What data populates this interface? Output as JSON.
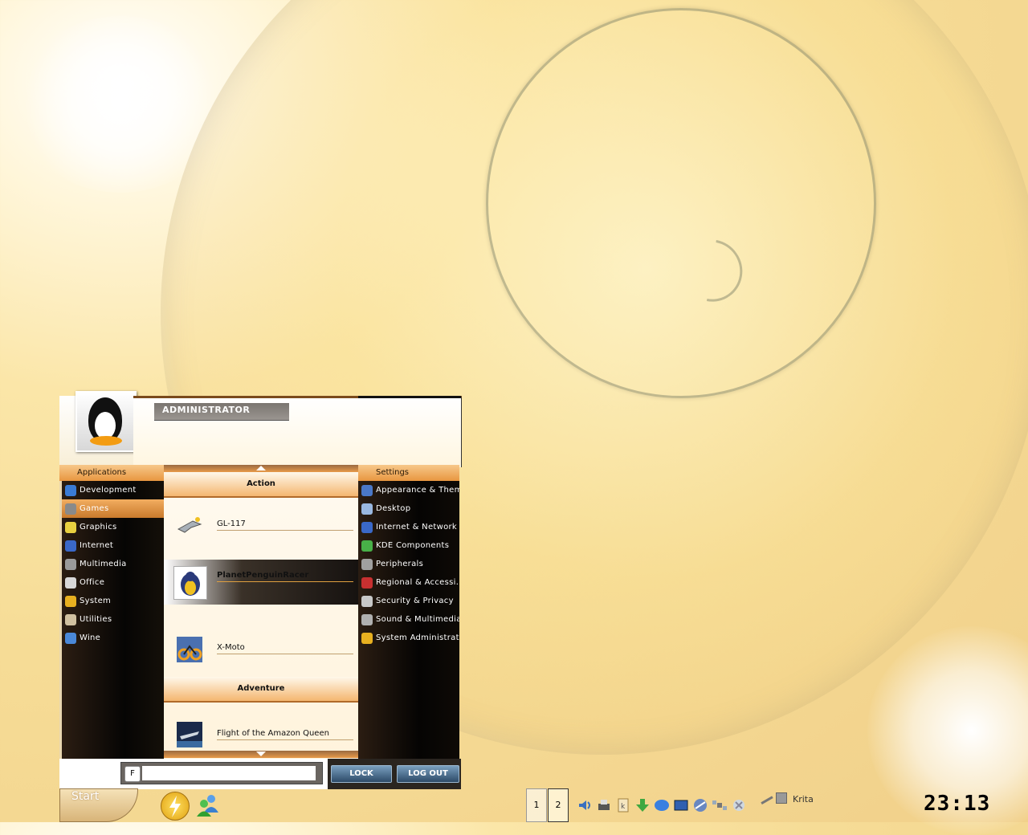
{
  "menu": {
    "user": "ADMINISTRATOR",
    "applications_header": "Applications",
    "settings_header": "Settings",
    "applications": [
      {
        "label": "Development",
        "icon": "development-icon",
        "color": "#3a7bd5"
      },
      {
        "label": "Games",
        "icon": "games-icon",
        "color": "#8a8a8a",
        "selected": true
      },
      {
        "label": "Graphics",
        "icon": "graphics-icon",
        "color": "#e8d040"
      },
      {
        "label": "Internet",
        "icon": "internet-icon",
        "color": "#3a68c8"
      },
      {
        "label": "Multimedia",
        "icon": "multimedia-icon",
        "color": "#9a9a9a"
      },
      {
        "label": "Office",
        "icon": "office-icon",
        "color": "#d8d8d8"
      },
      {
        "label": "System",
        "icon": "system-icon",
        "color": "#e8b020"
      },
      {
        "label": "Utilities",
        "icon": "utilities-icon",
        "color": "#d0c0a0"
      },
      {
        "label": "Wine",
        "icon": "wine-icon",
        "color": "#4a88d8"
      }
    ],
    "settings": [
      {
        "label": "Appearance & Them...",
        "icon": "appearance-icon",
        "color": "#4a78c8"
      },
      {
        "label": "Desktop",
        "icon": "desktop-icon",
        "color": "#9ab8e0"
      },
      {
        "label": "Internet & Network",
        "icon": "network-icon",
        "color": "#3a68c8"
      },
      {
        "label": "KDE Components",
        "icon": "components-icon",
        "color": "#48b048"
      },
      {
        "label": "Peripherals",
        "icon": "peripherals-icon",
        "color": "#a0a0a0"
      },
      {
        "label": "Regional & Accessi...",
        "icon": "regional-icon",
        "color": "#c83030"
      },
      {
        "label": "Security & Privacy",
        "icon": "security-icon",
        "color": "#c8c8c8"
      },
      {
        "label": "Sound & Multimedia",
        "icon": "sound-icon",
        "color": "#b0b0b0"
      },
      {
        "label": "System Administrati...",
        "icon": "sysadmin-icon",
        "color": "#e8b020"
      }
    ],
    "categories": [
      {
        "name": "Action",
        "entries": [
          {
            "label": "GL-117",
            "icon": "gl117-icon"
          },
          {
            "label": "PlanetPenguinRacer",
            "icon": "planetpenguinracer-icon",
            "selected": true
          },
          {
            "label": "X-Moto",
            "icon": "xmoto-icon"
          }
        ]
      },
      {
        "name": "Adventure",
        "entries": [
          {
            "label": "Flight of the Amazon Queen",
            "icon": "amazon-queen-icon"
          }
        ]
      }
    ],
    "search_placeholder": "",
    "lock_label": "LOCK",
    "logout_label": "LOG OUT"
  },
  "taskbar": {
    "start_label": "Start",
    "pager": [
      "1",
      "2"
    ],
    "active_desktop": "2",
    "task_label": "Krita",
    "clock": "23:13",
    "tray_icons": [
      "volume-icon",
      "printer-icon",
      "klipper-icon",
      "download-icon",
      "network-status-icon",
      "display-icon",
      "kget-icon",
      "satellite-icon",
      "update-icon"
    ]
  }
}
